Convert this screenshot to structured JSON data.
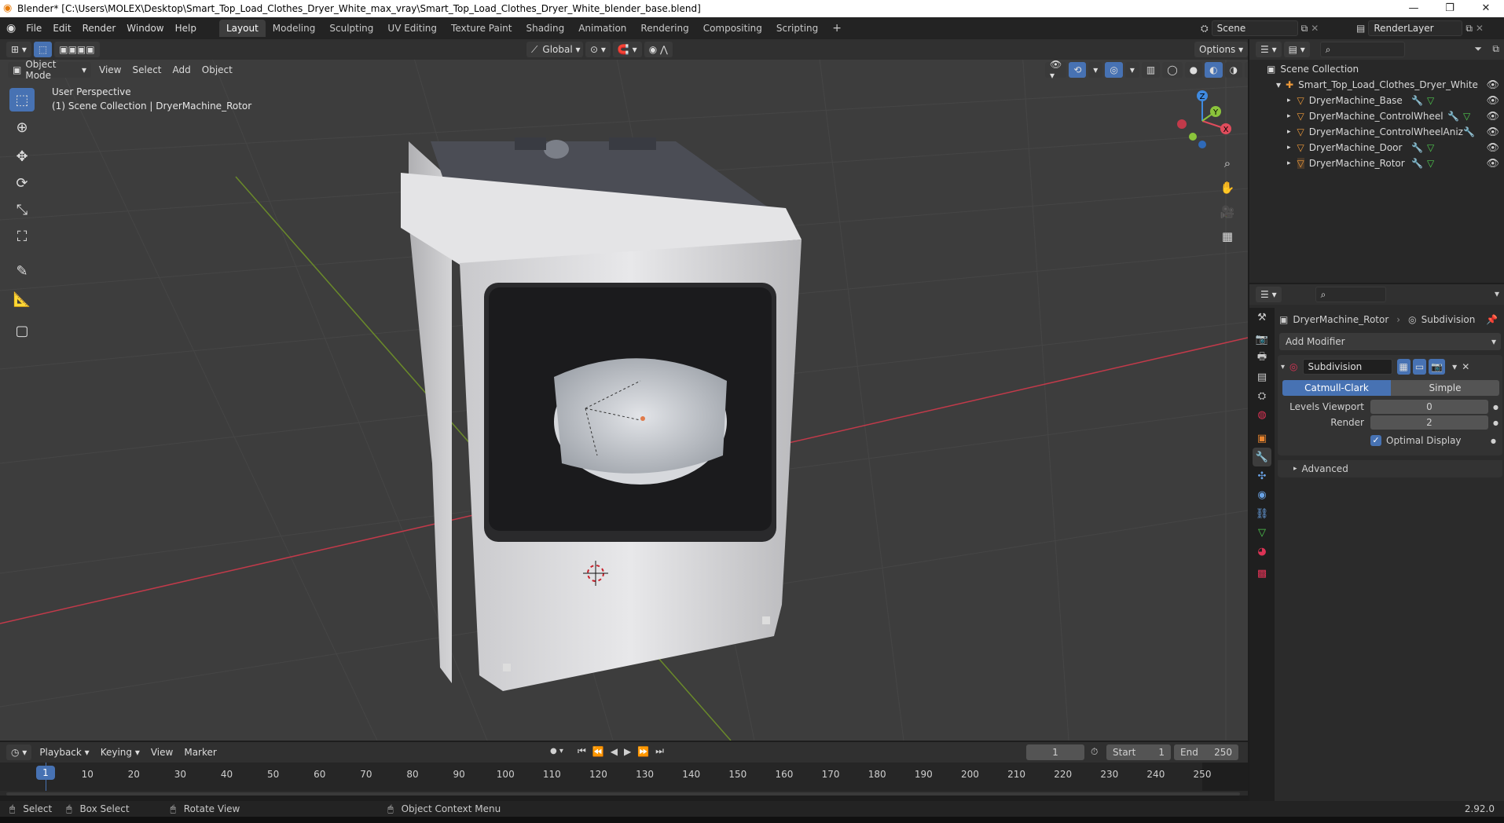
{
  "window": {
    "title": "Blender* [C:\\Users\\MOLEX\\Desktop\\Smart_Top_Load_Clothes_Dryer_White_max_vray\\Smart_Top_Load_Clothes_Dryer_White_blender_base.blend]",
    "min": "—",
    "max": "❐",
    "close": "✕"
  },
  "menu": [
    "File",
    "Edit",
    "Render",
    "Window",
    "Help"
  ],
  "workspaces": [
    "Layout",
    "Modeling",
    "Sculpting",
    "UV Editing",
    "Texture Paint",
    "Shading",
    "Animation",
    "Rendering",
    "Compositing",
    "Scripting"
  ],
  "active_workspace": "Layout",
  "scene_name": "Scene",
  "view_layer": "RenderLayer",
  "viewport": {
    "mode": "Object Mode",
    "menus": [
      "View",
      "Select",
      "Add",
      "Object"
    ],
    "orientation": "Global",
    "options_label": "Options",
    "perspective": "User Perspective",
    "context": "(1) Scene Collection | DryerMachine_Rotor",
    "gizmo": {
      "x": "X",
      "y": "Y",
      "z": "Z"
    }
  },
  "outliner": {
    "root": "Scene Collection",
    "collection": "Smart_Top_Load_Clothes_Dryer_White",
    "objects": [
      "DryerMachine_Base",
      "DryerMachine_ControlWheel",
      "DryerMachine_ControlWheelAniz",
      "DryerMachine_Door",
      "DryerMachine_Rotor"
    ]
  },
  "properties": {
    "object_name": "DryerMachine_Rotor",
    "modifier_crumb": "Subdivision",
    "add_modifier": "Add Modifier",
    "modifier_name": "Subdivision",
    "algo_options": [
      "Catmull-Clark",
      "Simple"
    ],
    "levels_viewport_label": "Levels Viewport",
    "levels_viewport_value": "0",
    "render_label": "Render",
    "render_value": "2",
    "optimal_display": "Optimal Display",
    "advanced": "Advanced"
  },
  "timeline": {
    "menus": [
      "Playback",
      "Keying",
      "View",
      "Marker"
    ],
    "current_frame": "1",
    "start_label": "Start",
    "start": "1",
    "end_label": "End",
    "end": "250",
    "ticks": [
      "1",
      "10",
      "20",
      "30",
      "40",
      "50",
      "60",
      "70",
      "80",
      "90",
      "100",
      "110",
      "120",
      "130",
      "140",
      "150",
      "160",
      "170",
      "180",
      "190",
      "200",
      "210",
      "220",
      "230",
      "240",
      "250"
    ]
  },
  "status": {
    "select": "Select",
    "box_select": "Box Select",
    "rotate_view": "Rotate View",
    "context_menu": "Object Context Menu",
    "version": "2.92.0"
  },
  "colors": {
    "accent": "#4772b3",
    "x_axis": "#e04c5c",
    "y_axis": "#8bc43b",
    "z_axis": "#3f8ae0"
  }
}
